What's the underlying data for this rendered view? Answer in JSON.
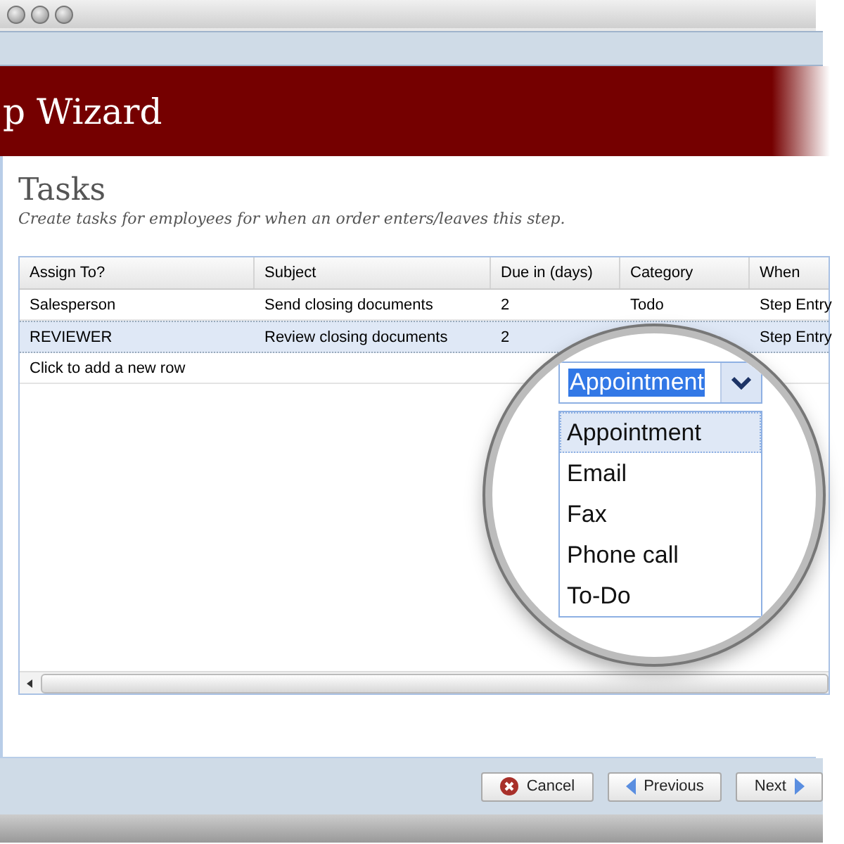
{
  "window": {
    "title": "p Wizard"
  },
  "page": {
    "title": "Tasks",
    "subtitle": "Create tasks for employees for when an order enters/leaves this step."
  },
  "table": {
    "columns": [
      "Assign To?",
      "Subject",
      "Due in (days)",
      "Category",
      "When"
    ],
    "rows": [
      {
        "cells": [
          "Salesperson",
          "Send closing documents",
          "2",
          "Todo",
          "Step Entry"
        ],
        "selected": false
      },
      {
        "cells": [
          "REVIEWER",
          "Review closing documents",
          "2",
          "",
          "Step Entry"
        ],
        "selected": true
      }
    ],
    "new_row": "Click to add a new row"
  },
  "category_editor": {
    "value": "Appointment",
    "options": [
      {
        "label": "Appointment",
        "selected": true
      },
      {
        "label": "Email",
        "selected": false
      },
      {
        "label": "Fax",
        "selected": false
      },
      {
        "label": "Phone call",
        "selected": false
      },
      {
        "label": "To-Do",
        "selected": false
      }
    ]
  },
  "buttons": [
    {
      "label": "Cancel",
      "kind": "cancel"
    },
    {
      "label": "Previous",
      "kind": "previous"
    },
    {
      "label": "Next",
      "kind": "next"
    }
  ]
}
